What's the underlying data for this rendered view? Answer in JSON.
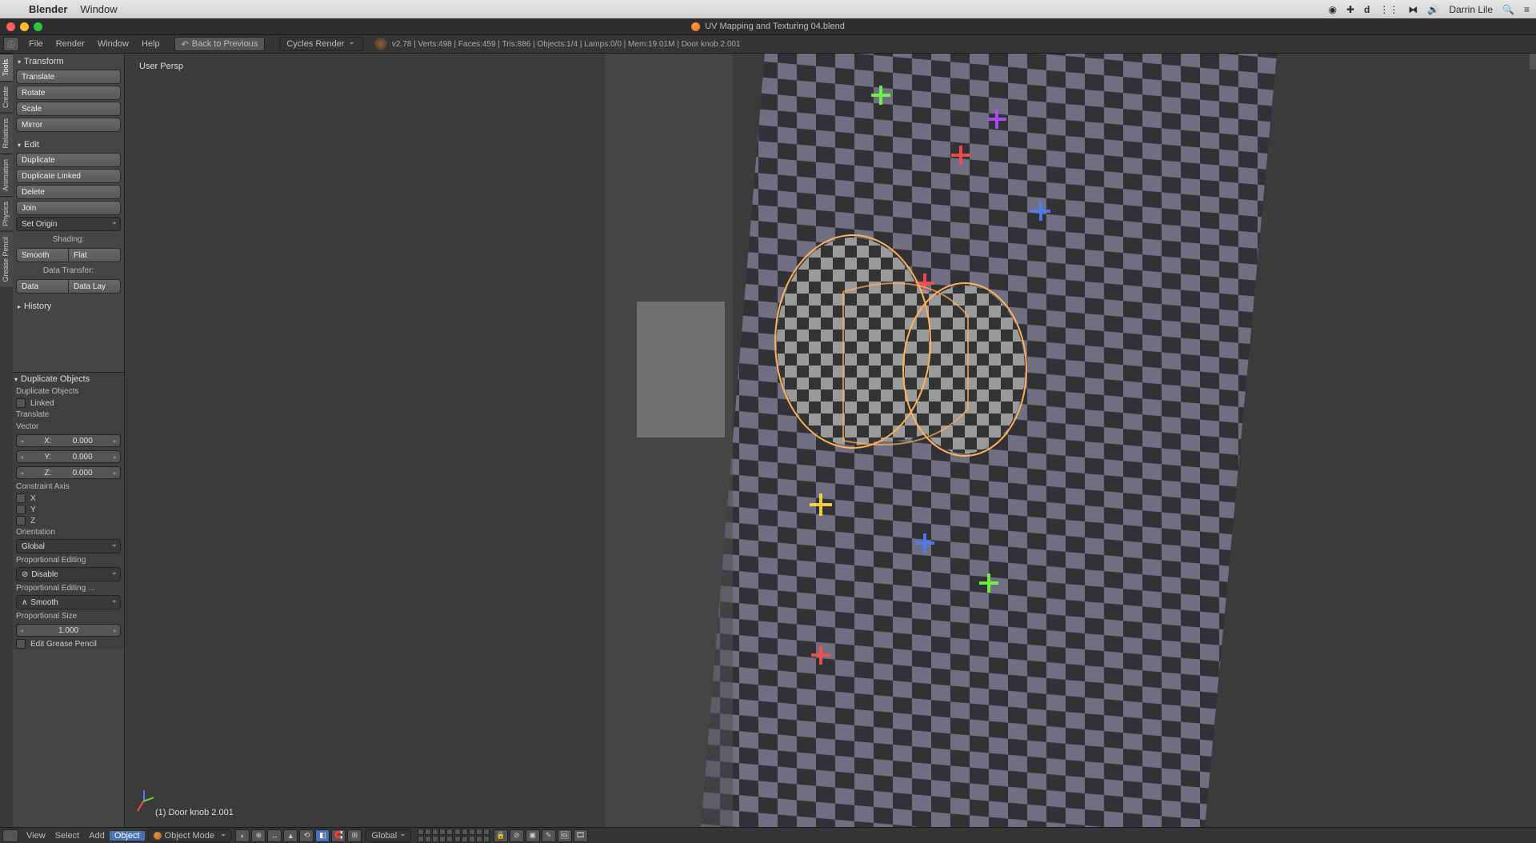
{
  "mac": {
    "app": "Blender",
    "menu": [
      "Window"
    ],
    "user": "Darrin Lile"
  },
  "titlebar": {
    "filename": "UV Mapping and Texturing 04.blend"
  },
  "info": {
    "menus": {
      "file": "File",
      "render": "Render",
      "window": "Window",
      "help": "Help"
    },
    "back": "Back to Previous",
    "engine": "Cycles Render",
    "stats": "v2.78 | Verts:498 | Faces:459 | Tris:886 | Objects:1/4 | Lamps:0/0 | Mem:19.01M | Door knob 2.001"
  },
  "sidetabs": [
    "Tools",
    "Create",
    "Relations",
    "Animation",
    "Physics",
    "Grease Pencil"
  ],
  "toolshelf": {
    "transform": {
      "header": "Transform",
      "translate": "Translate",
      "rotate": "Rotate",
      "scale": "Scale",
      "mirror": "Mirror"
    },
    "edit": {
      "header": "Edit",
      "duplicate": "Duplicate",
      "duplicate_linked": "Duplicate Linked",
      "delete": "Delete",
      "join": "Join",
      "set_origin": "Set Origin"
    },
    "shading": {
      "header": "Shading:",
      "smooth": "Smooth",
      "flat": "Flat"
    },
    "datatransfer": {
      "header": "Data Transfer:",
      "data": "Data",
      "datalay": "Data Lay"
    },
    "history": {
      "header": "History"
    }
  },
  "operator": {
    "title": "Duplicate Objects",
    "duplicate_objects": "Duplicate Objects",
    "linked": "Linked",
    "translate": "Translate",
    "vector": "Vector",
    "x": "X:",
    "xval": "0.000",
    "y": "Y:",
    "yval": "0.000",
    "z": "Z:",
    "zval": "0.000",
    "constraint_axis": "Constraint Axis",
    "cx": "X",
    "cy": "Y",
    "cz": "Z",
    "orientation": "Orientation",
    "orientation_val": "Global",
    "prop_edit": "Proportional Editing",
    "prop_edit_val": "Disable",
    "prop_fall": "Proportional Editing ...",
    "prop_fall_val": "Smooth",
    "prop_size": "Proportional Size",
    "prop_size_val": "1.000",
    "edit_gp": "Edit Grease Pencil"
  },
  "viewport": {
    "persp": "User Persp",
    "object": "(1) Door knob 2.001"
  },
  "vp_header": {
    "menus": {
      "view": "View",
      "select": "Select",
      "add": "Add",
      "object": "Object"
    },
    "mode": "Object Mode",
    "orientation": "Global"
  }
}
